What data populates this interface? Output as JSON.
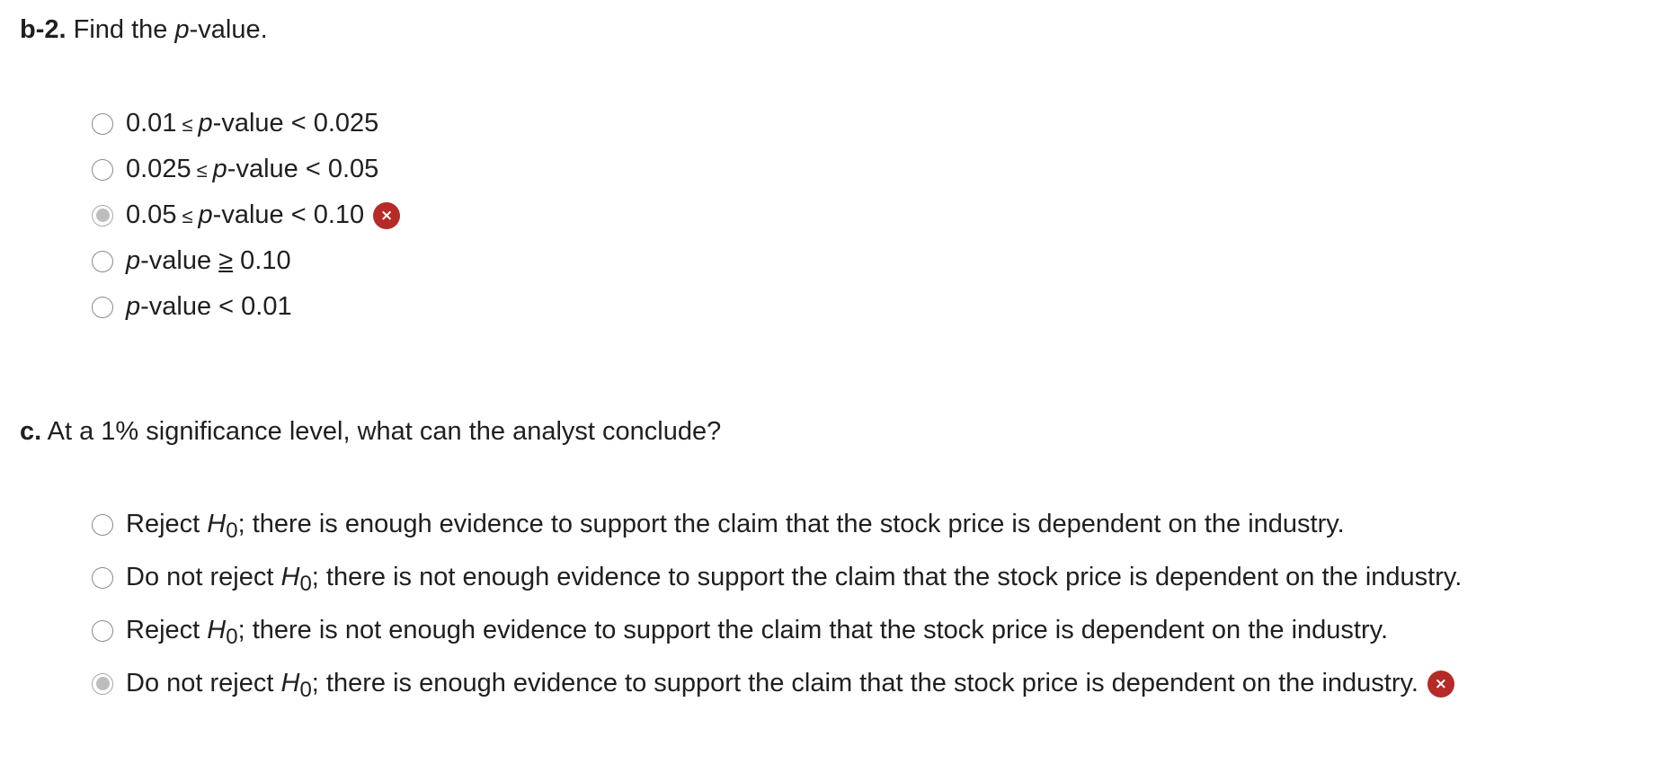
{
  "question_b2": {
    "label": "b-2.",
    "text_before": " Find the ",
    "text_italic": "p",
    "text_after": "-value."
  },
  "options_b2": [
    {
      "lower": "0.01",
      "op": "≤",
      "var": "p",
      "suffix": "-value < 0.025",
      "selected": false,
      "marked_wrong": false
    },
    {
      "lower": "0.025",
      "op": "≤",
      "var": "p",
      "suffix": "-value < 0.05",
      "selected": false,
      "marked_wrong": false
    },
    {
      "lower": "0.05",
      "op": "≤",
      "var": "p",
      "suffix": "-value < 0.10",
      "selected": true,
      "marked_wrong": true
    },
    {
      "var": "p",
      "mid": "-value ",
      "op": "≥",
      "suffix": " 0.10",
      "selected": false,
      "marked_wrong": false
    },
    {
      "var": "p",
      "suffix": "-value < 0.01",
      "selected": false,
      "marked_wrong": false
    }
  ],
  "question_c": {
    "label": "c.",
    "text": " At a 1% significance level, what can the analyst conclude?"
  },
  "options_c": [
    {
      "pre": "Reject ",
      "h": "H",
      "sub": "0",
      "post": "; there is enough evidence to support the claim that the stock price is dependent on the industry.",
      "selected": false,
      "marked_wrong": false
    },
    {
      "pre": "Do not reject ",
      "h": "H",
      "sub": "0",
      "post": "; there is not enough evidence to support the claim that the stock price is dependent on the industry.",
      "selected": false,
      "marked_wrong": false
    },
    {
      "pre": "Reject ",
      "h": "H",
      "sub": "0",
      "post": "; there is not enough evidence to support the claim that the stock price is dependent on the industry.",
      "selected": false,
      "marked_wrong": false
    },
    {
      "pre": "Do not reject ",
      "h": "H",
      "sub": "0",
      "post": "; there is enough evidence to support the claim that the stock price is dependent on the industry.",
      "selected": true,
      "marked_wrong": true
    }
  ],
  "icons": {
    "wrong_mark": "×"
  },
  "colors": {
    "wrong_badge": "#b52b27",
    "selected_dot": "#bdbdbd",
    "text": "#1f1f1f"
  }
}
